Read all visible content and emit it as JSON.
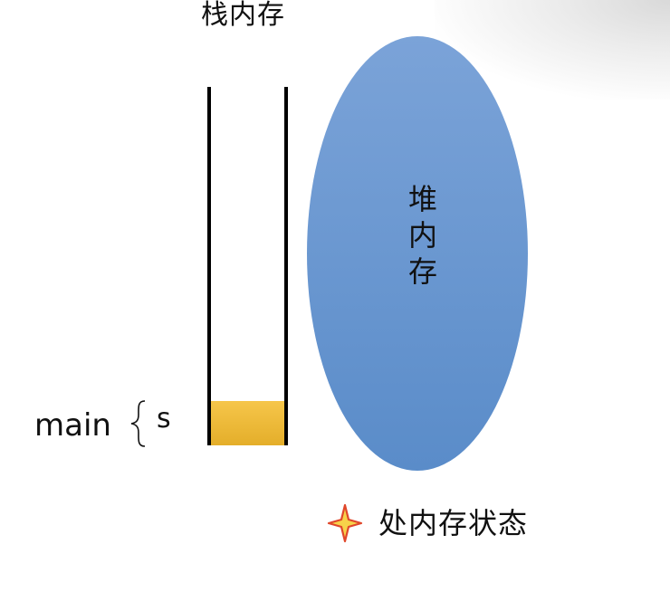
{
  "stack": {
    "title": "栈内存",
    "frame_label": "main",
    "variable": "s"
  },
  "heap": {
    "label_chars": [
      "堆",
      "内",
      "存"
    ]
  },
  "caption": {
    "text": "处内存状态"
  },
  "colors": {
    "heap_fill_top": "#7ba3d8",
    "heap_fill_bottom": "#5a8cc9",
    "frame_fill": "#f2bf3f",
    "star_fill": "#f7d24a",
    "star_outline": "#e0472b"
  }
}
